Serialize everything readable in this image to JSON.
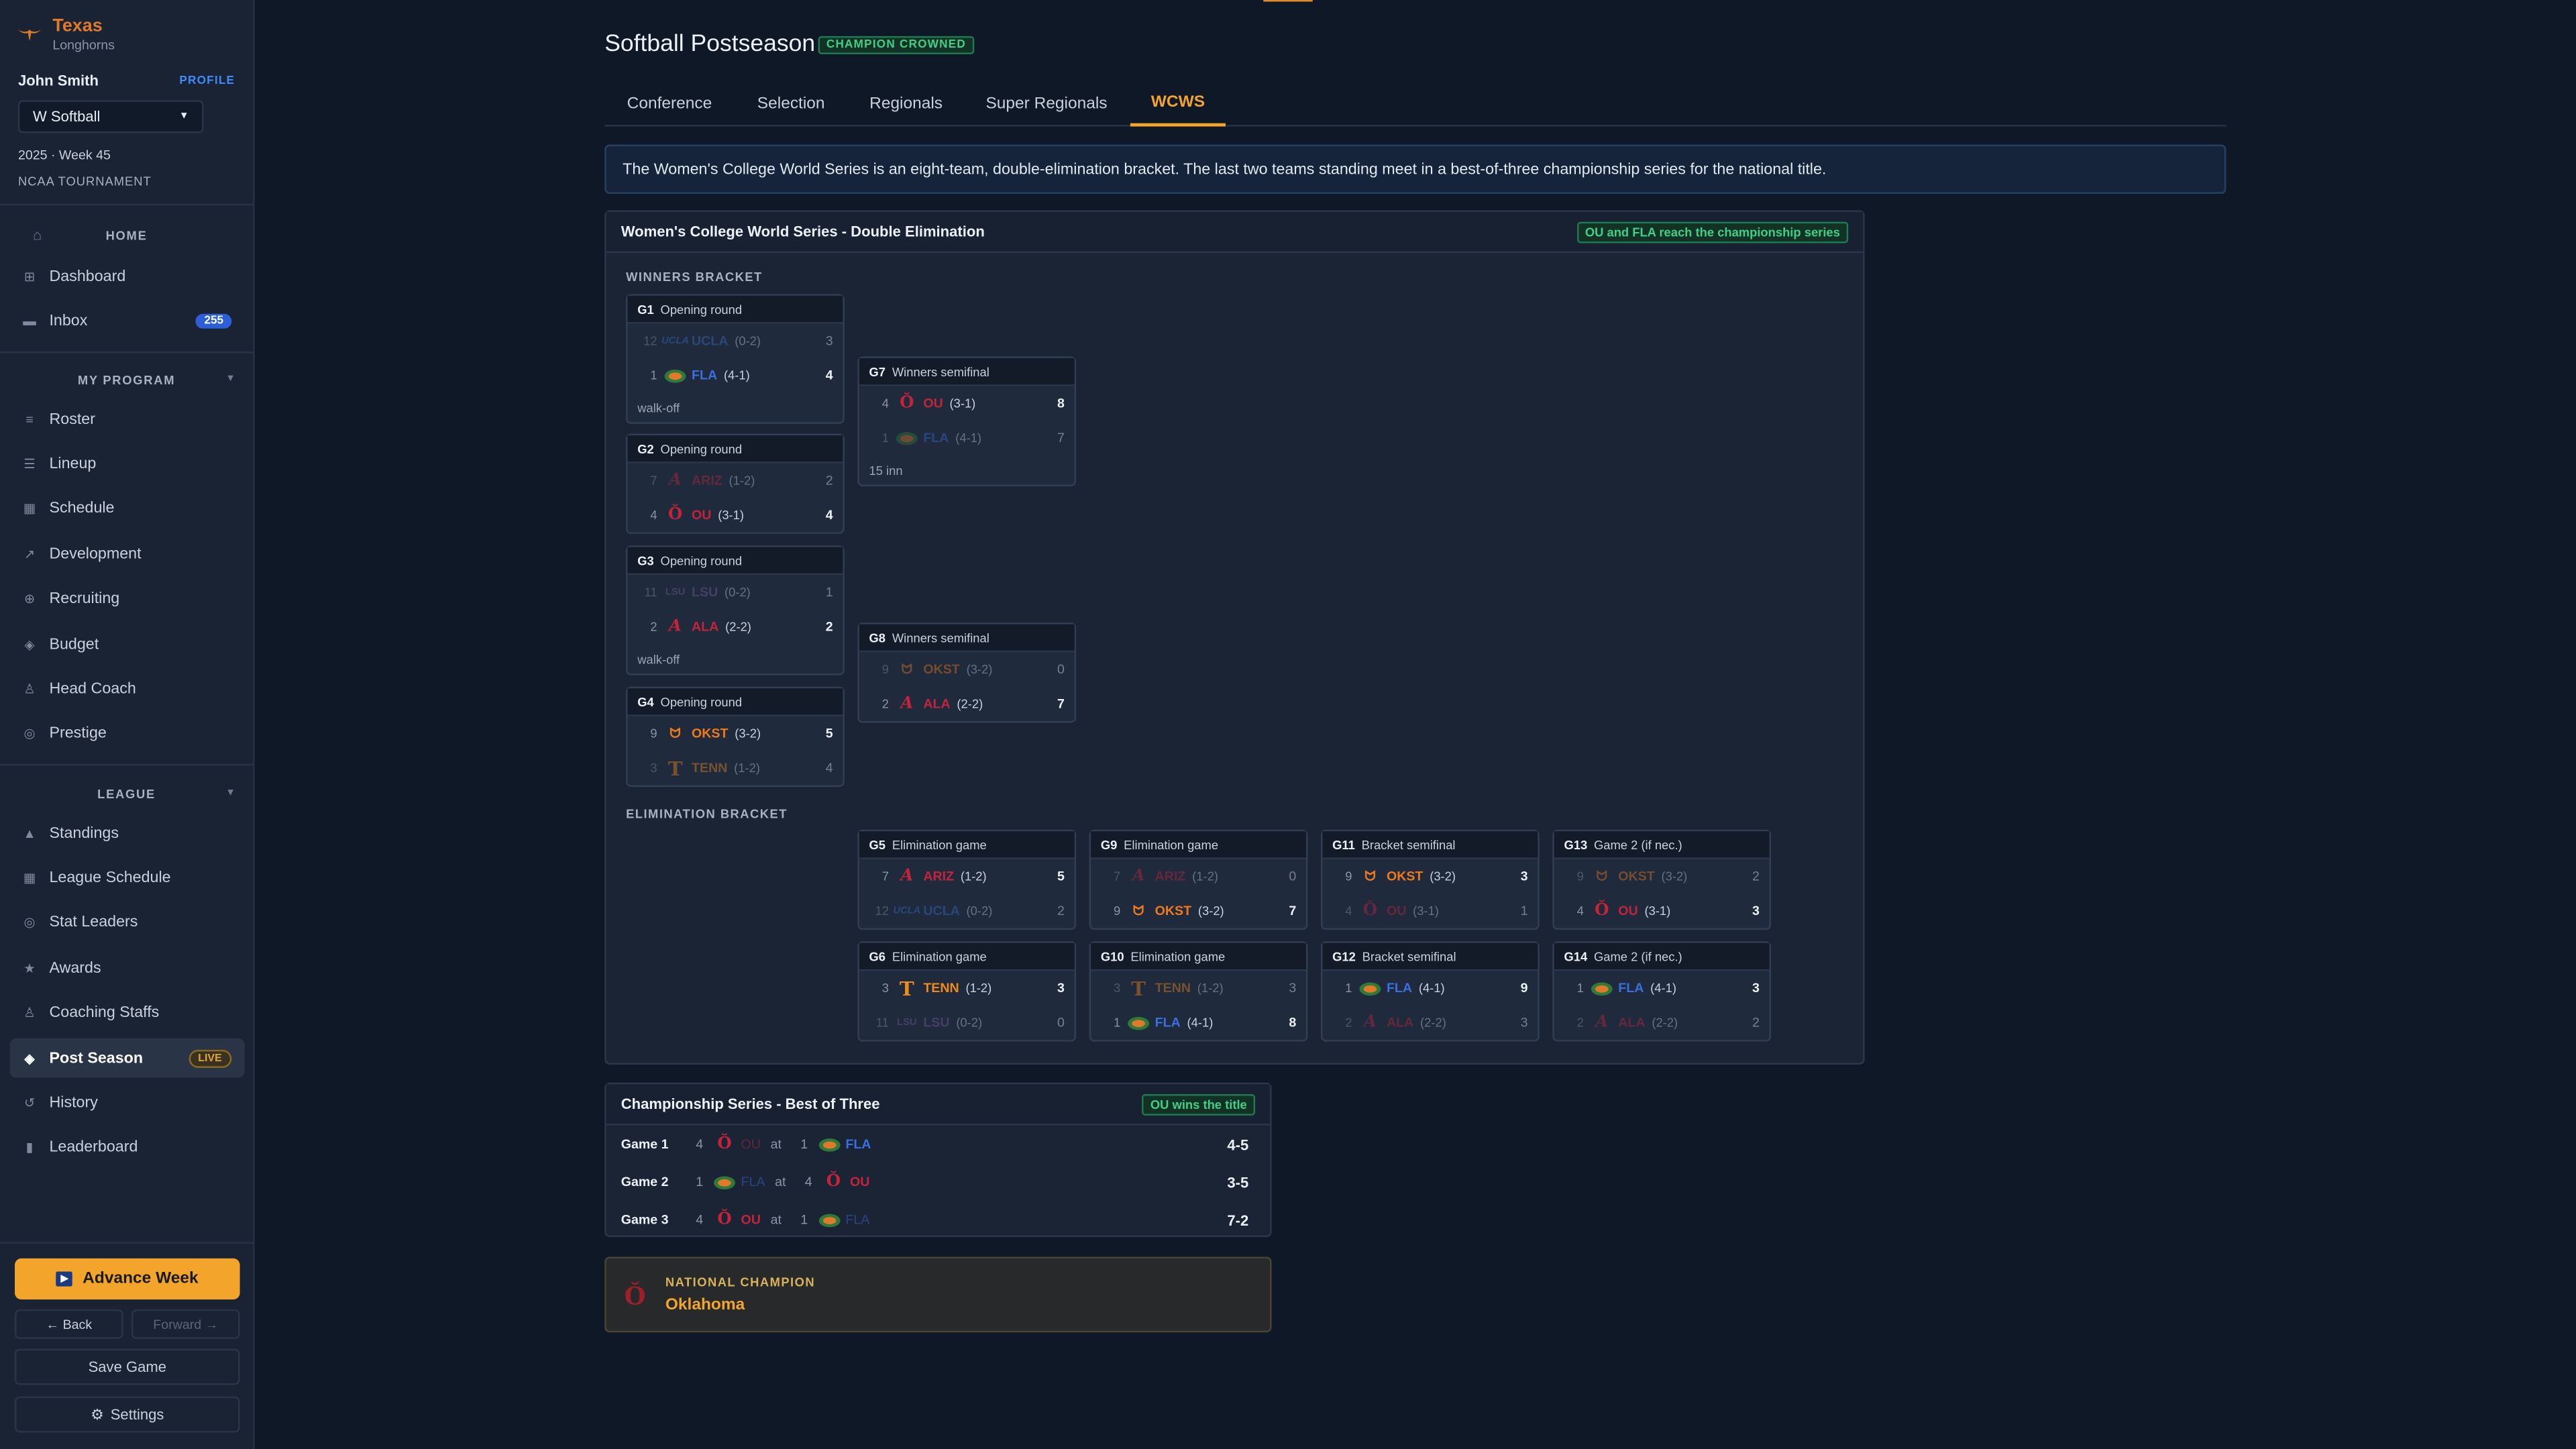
{
  "sidebar": {
    "brand": {
      "school": "Texas",
      "mascot": "Longhorns"
    },
    "user": {
      "name": "John Smith",
      "profile_label": "PROFILE"
    },
    "sport_select": "W Softball",
    "season_line": "2025 · Week 45",
    "phase_line": "NCAA TOURNAMENT",
    "home_section": "HOME",
    "home_items": [
      {
        "label": "Dashboard",
        "icon": "grid-icon"
      },
      {
        "label": "Inbox",
        "icon": "mail-icon",
        "badge": "255"
      }
    ],
    "program_section": "MY PROGRAM",
    "program_items": [
      {
        "label": "Roster",
        "icon": "list-icon"
      },
      {
        "label": "Lineup",
        "icon": "lines-icon"
      },
      {
        "label": "Schedule",
        "icon": "calendar-icon"
      },
      {
        "label": "Development",
        "icon": "trend-icon"
      },
      {
        "label": "Recruiting",
        "icon": "target-icon"
      },
      {
        "label": "Budget",
        "icon": "diamond-icon"
      },
      {
        "label": "Head Coach",
        "icon": "person-icon"
      },
      {
        "label": "Prestige",
        "icon": "circle-icon"
      }
    ],
    "league_section": "LEAGUE",
    "league_items": [
      {
        "label": "Standings",
        "icon": "triangle-icon"
      },
      {
        "label": "League Schedule",
        "icon": "calendar-icon"
      },
      {
        "label": "Stat Leaders",
        "icon": "circle-icon"
      },
      {
        "label": "Awards",
        "icon": "star-icon"
      },
      {
        "label": "Coaching Staffs",
        "icon": "person-icon"
      },
      {
        "label": "Post Season",
        "icon": "diamond-icon",
        "badge": "LIVE"
      },
      {
        "label": "History",
        "icon": "history-icon"
      },
      {
        "label": "Leaderboard",
        "icon": "bars-icon"
      }
    ],
    "advance_label": "Advance Week",
    "back_label": "← Back",
    "forward_label": "Forward →",
    "save_label": "Save Game",
    "settings_label": "Settings"
  },
  "header": {
    "title": "Softball Postseason",
    "status_tag": "CHAMPION CROWNED",
    "tabs": [
      "Conference",
      "Selection",
      "Regionals",
      "Super Regionals",
      "WCWS"
    ],
    "active_tab": "WCWS"
  },
  "info_text": "The Women's College World Series is an eight-team, double-elimination bracket. The last two teams standing meet in a best-of-three championship series for the national title.",
  "colors": {
    "accent": "#f3a52b",
    "bg": "#0f1826",
    "panel": "#1a2435",
    "ucla": "#3b6fd1",
    "fla": "#3a6fe0",
    "ou": "#c3243a",
    "ariz": "#c3243a",
    "ala": "#c3243a",
    "lsu": "#7a5ea6",
    "okst": "#f07a1a",
    "tenn": "#f08a1a",
    "success": "#3fcf87"
  },
  "bracket": {
    "title": "Women's College World Series - Double Elimination",
    "status": "OU and FLA reach the championship series",
    "winners_label": "WINNERS BRACKET",
    "elim_label": "ELIMINATION BRACKET",
    "games": {
      "g1": {
        "id": "G1",
        "round": "Opening round",
        "note": "walk-off",
        "teams": [
          {
            "seed": "12",
            "abbr": "UCLA",
            "rec": "(0-2)",
            "score": "3",
            "win": false,
            "logo": "UCLA",
            "color": "#3b6fd1"
          },
          {
            "seed": "1",
            "abbr": "FLA",
            "rec": "(4-1)",
            "score": "4",
            "win": true,
            "logo": "gator",
            "color": "#3a6fe0"
          }
        ]
      },
      "g2": {
        "id": "G2",
        "round": "Opening round",
        "note": "",
        "teams": [
          {
            "seed": "7",
            "abbr": "ARIZ",
            "rec": "(1-2)",
            "score": "2",
            "win": false,
            "logo": "A",
            "color": "#c3243a"
          },
          {
            "seed": "4",
            "abbr": "OU",
            "rec": "(3-1)",
            "score": "4",
            "win": true,
            "logo": "OU",
            "color": "#c3243a"
          }
        ]
      },
      "g3": {
        "id": "G3",
        "round": "Opening round",
        "note": "walk-off",
        "teams": [
          {
            "seed": "11",
            "abbr": "LSU",
            "rec": "(0-2)",
            "score": "1",
            "win": false,
            "logo": "LSU",
            "color": "#7a5ea6"
          },
          {
            "seed": "2",
            "abbr": "ALA",
            "rec": "(2-2)",
            "score": "2",
            "win": true,
            "logo": "A",
            "color": "#c3243a"
          }
        ]
      },
      "g4": {
        "id": "G4",
        "round": "Opening round",
        "note": "",
        "teams": [
          {
            "seed": "9",
            "abbr": "OKST",
            "rec": "(3-2)",
            "score": "5",
            "win": true,
            "logo": "OSU",
            "color": "#f07a1a"
          },
          {
            "seed": "3",
            "abbr": "TENN",
            "rec": "(1-2)",
            "score": "4",
            "win": false,
            "logo": "T",
            "color": "#f08a1a"
          }
        ]
      },
      "g7": {
        "id": "G7",
        "round": "Winners semifinal",
        "note": "15 inn",
        "teams": [
          {
            "seed": "4",
            "abbr": "OU",
            "rec": "(3-1)",
            "score": "8",
            "win": true,
            "logo": "OU",
            "color": "#c3243a"
          },
          {
            "seed": "1",
            "abbr": "FLA",
            "rec": "(4-1)",
            "score": "7",
            "win": false,
            "logo": "gator",
            "color": "#3a6fe0"
          }
        ]
      },
      "g8": {
        "id": "G8",
        "round": "Winners semifinal",
        "note": "",
        "teams": [
          {
            "seed": "9",
            "abbr": "OKST",
            "rec": "(3-2)",
            "score": "0",
            "win": false,
            "logo": "OSU",
            "color": "#f07a1a"
          },
          {
            "seed": "2",
            "abbr": "ALA",
            "rec": "(2-2)",
            "score": "7",
            "win": true,
            "logo": "A",
            "color": "#c3243a"
          }
        ]
      },
      "g5": {
        "id": "G5",
        "round": "Elimination game",
        "note": "",
        "teams": [
          {
            "seed": "7",
            "abbr": "ARIZ",
            "rec": "(1-2)",
            "score": "5",
            "win": true,
            "logo": "A",
            "color": "#c3243a"
          },
          {
            "seed": "12",
            "abbr": "UCLA",
            "rec": "(0-2)",
            "score": "2",
            "win": false,
            "logo": "UCLA",
            "color": "#3b6fd1"
          }
        ]
      },
      "g6": {
        "id": "G6",
        "round": "Elimination game",
        "note": "",
        "teams": [
          {
            "seed": "3",
            "abbr": "TENN",
            "rec": "(1-2)",
            "score": "3",
            "win": true,
            "logo": "T",
            "color": "#f08a1a"
          },
          {
            "seed": "11",
            "abbr": "LSU",
            "rec": "(0-2)",
            "score": "0",
            "win": false,
            "logo": "LSU",
            "color": "#7a5ea6"
          }
        ]
      },
      "g9": {
        "id": "G9",
        "round": "Elimination game",
        "note": "",
        "teams": [
          {
            "seed": "7",
            "abbr": "ARIZ",
            "rec": "(1-2)",
            "score": "0",
            "win": false,
            "logo": "A",
            "color": "#c3243a"
          },
          {
            "seed": "9",
            "abbr": "OKST",
            "rec": "(3-2)",
            "score": "7",
            "win": true,
            "logo": "OSU",
            "color": "#f07a1a"
          }
        ]
      },
      "g10": {
        "id": "G10",
        "round": "Elimination game",
        "note": "",
        "teams": [
          {
            "seed": "3",
            "abbr": "TENN",
            "rec": "(1-2)",
            "score": "3",
            "win": false,
            "logo": "T",
            "color": "#f08a1a"
          },
          {
            "seed": "1",
            "abbr": "FLA",
            "rec": "(4-1)",
            "score": "8",
            "win": true,
            "logo": "gator",
            "color": "#3a6fe0"
          }
        ]
      },
      "g11": {
        "id": "G11",
        "round": "Bracket semifinal",
        "note": "",
        "teams": [
          {
            "seed": "9",
            "abbr": "OKST",
            "rec": "(3-2)",
            "score": "3",
            "win": true,
            "logo": "OSU",
            "color": "#f07a1a"
          },
          {
            "seed": "4",
            "abbr": "OU",
            "rec": "(3-1)",
            "score": "1",
            "win": false,
            "logo": "OU",
            "color": "#c3243a"
          }
        ]
      },
      "g12": {
        "id": "G12",
        "round": "Bracket semifinal",
        "note": "",
        "teams": [
          {
            "seed": "1",
            "abbr": "FLA",
            "rec": "(4-1)",
            "score": "9",
            "win": true,
            "logo": "gator",
            "color": "#3a6fe0"
          },
          {
            "seed": "2",
            "abbr": "ALA",
            "rec": "(2-2)",
            "score": "3",
            "win": false,
            "logo": "A",
            "color": "#c3243a"
          }
        ]
      },
      "g13": {
        "id": "G13",
        "round": "Game 2 (if nec.)",
        "note": "",
        "teams": [
          {
            "seed": "9",
            "abbr": "OKST",
            "rec": "(3-2)",
            "score": "2",
            "win": false,
            "logo": "OSU",
            "color": "#f07a1a"
          },
          {
            "seed": "4",
            "abbr": "OU",
            "rec": "(3-1)",
            "score": "3",
            "win": true,
            "logo": "OU",
            "color": "#c3243a"
          }
        ]
      },
      "g14": {
        "id": "G14",
        "round": "Game 2 (if nec.)",
        "note": "",
        "teams": [
          {
            "seed": "1",
            "abbr": "FLA",
            "rec": "(4-1)",
            "score": "3",
            "win": true,
            "logo": "gator",
            "color": "#3a6fe0"
          },
          {
            "seed": "2",
            "abbr": "ALA",
            "rec": "(2-2)",
            "score": "2",
            "win": false,
            "logo": "A",
            "color": "#c3243a"
          }
        ]
      }
    }
  },
  "championship": {
    "title": "Championship Series - Best of Three",
    "status": "OU wins the title",
    "at_label": "at",
    "games": [
      {
        "label": "Game 1",
        "away": {
          "seed": "4",
          "abbr": "OU",
          "logo": "OU",
          "color": "#c3243a",
          "win": false
        },
        "home": {
          "seed": "1",
          "abbr": "FLA",
          "logo": "gator",
          "color": "#3a6fe0",
          "win": true
        },
        "result": "4-5"
      },
      {
        "label": "Game 2",
        "away": {
          "seed": "1",
          "abbr": "FLA",
          "logo": "gator",
          "color": "#3a6fe0",
          "win": false
        },
        "home": {
          "seed": "4",
          "abbr": "OU",
          "logo": "OU",
          "color": "#c3243a",
          "win": true
        },
        "result": "3-5"
      },
      {
        "label": "Game 3",
        "away": {
          "seed": "4",
          "abbr": "OU",
          "logo": "OU",
          "color": "#c3243a",
          "win": true
        },
        "home": {
          "seed": "1",
          "abbr": "FLA",
          "logo": "gator",
          "color": "#3a6fe0",
          "win": false
        },
        "result": "7-2"
      }
    ]
  },
  "national_champion": {
    "label": "NATIONAL CHAMPION",
    "name": "Oklahoma"
  }
}
